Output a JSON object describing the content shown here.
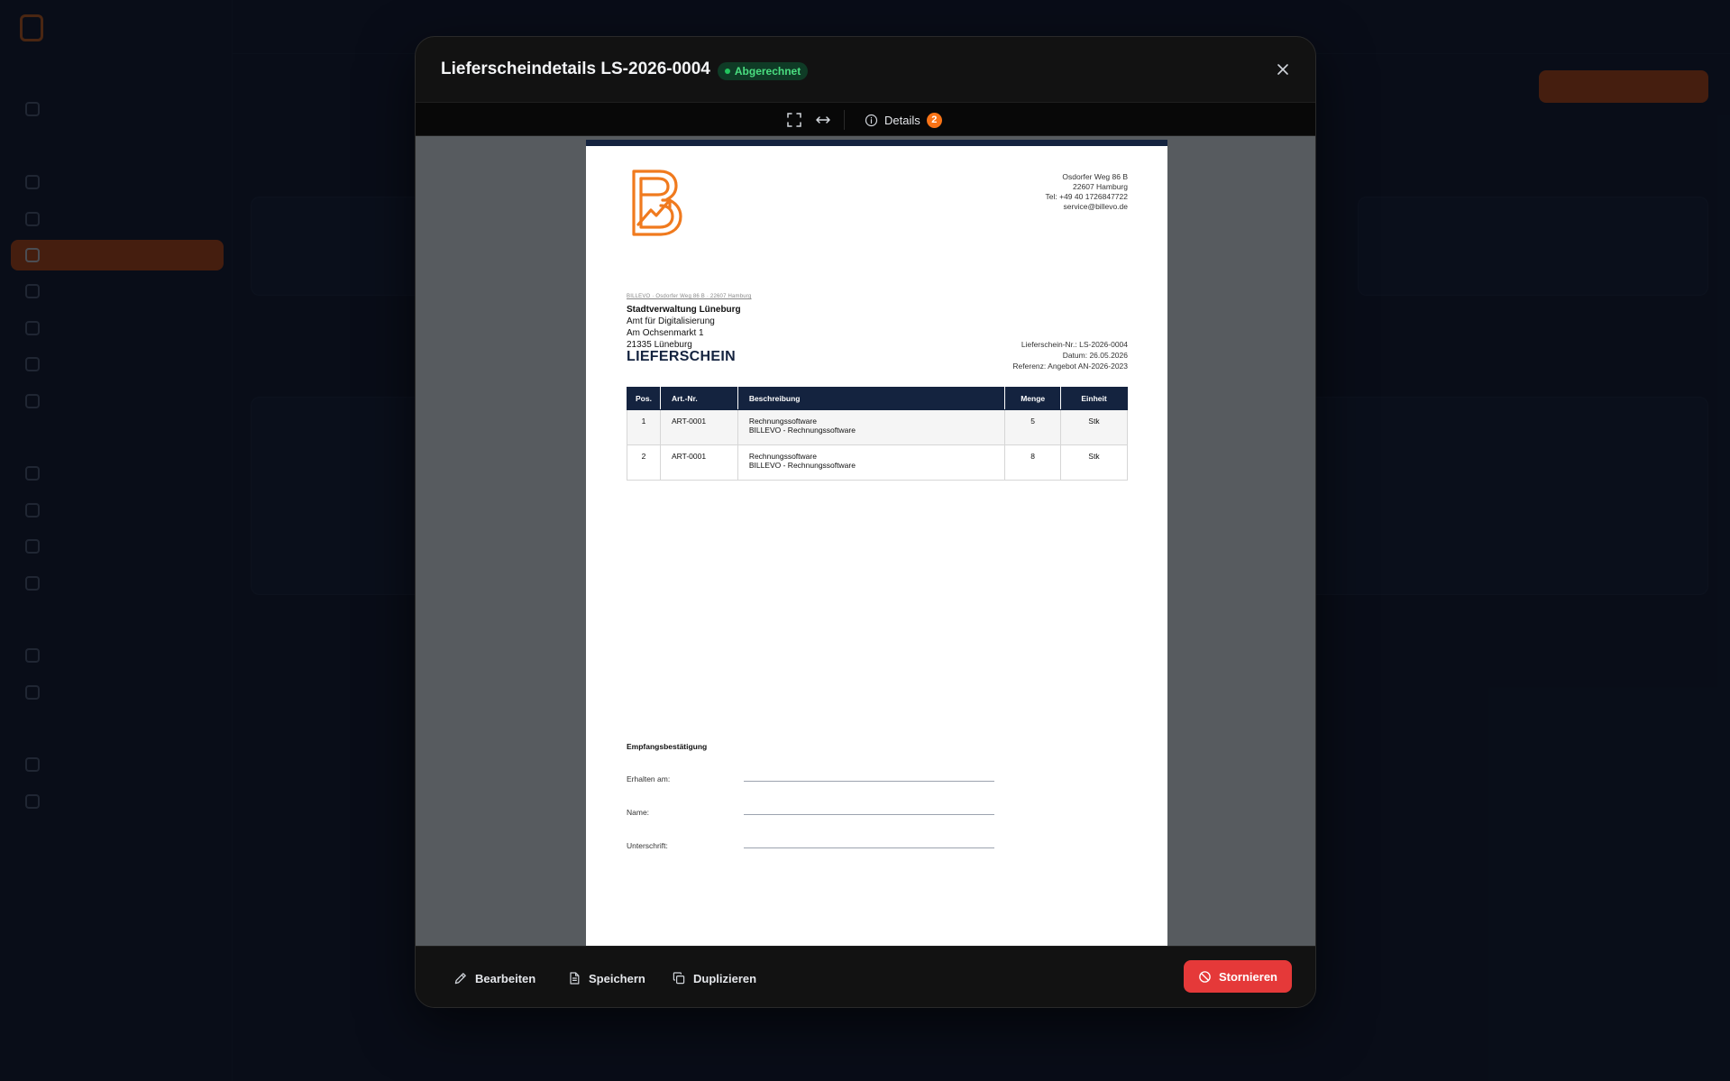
{
  "modal": {
    "title": "Lieferscheindetails LS-2026-0004",
    "status": "Abgerechnet",
    "details_label": "Details",
    "details_count": "2"
  },
  "document": {
    "company": {
      "street": "Osdorfer Weg 86 B",
      "city": "22607 Hamburg",
      "phone": "Tel: +49 40 1726847722",
      "email": "service@billevo.de"
    },
    "sender_line": "BILLEVO · Osdorfer Weg 86 B · 22607 Hamburg",
    "recipient": {
      "name": "Stadtverwaltung Lüneburg",
      "department": "Amt für Digitalisierung",
      "street": "Am Ochsenmarkt 1",
      "city": "21335 Lüneburg"
    },
    "meta": {
      "number": "Lieferschein-Nr.: LS-2026-0004",
      "date": "Datum: 26.05.2026",
      "reference": "Referenz: Angebot AN-2026-2023"
    },
    "title": "LIEFERSCHEIN",
    "table": {
      "headers": [
        "Pos.",
        "Art.-Nr.",
        "Beschreibung",
        "Menge",
        "Einheit"
      ],
      "rows": [
        {
          "pos": "1",
          "art": "ART-0001",
          "desc1": "Rechnungssoftware",
          "desc2": "BILLEVO - Rechnungssoftware",
          "qty": "5",
          "unit": "Stk"
        },
        {
          "pos": "2",
          "art": "ART-0001",
          "desc1": "Rechnungssoftware",
          "desc2": "BILLEVO - Rechnungssoftware",
          "qty": "8",
          "unit": "Stk"
        }
      ]
    },
    "receipt": {
      "title": "Empfangsbestätigung",
      "received": "Erhalten am:",
      "name": "Name:",
      "signature": "Unterschrift:"
    }
  },
  "footer": {
    "edit": "Bearbeiten",
    "save": "Speichern",
    "duplicate": "Duplizieren",
    "cancel": "Stornieren"
  },
  "colors": {
    "accent": "#f97316",
    "navy": "#14233f",
    "danger": "#e53939",
    "success": "#22c55e"
  }
}
